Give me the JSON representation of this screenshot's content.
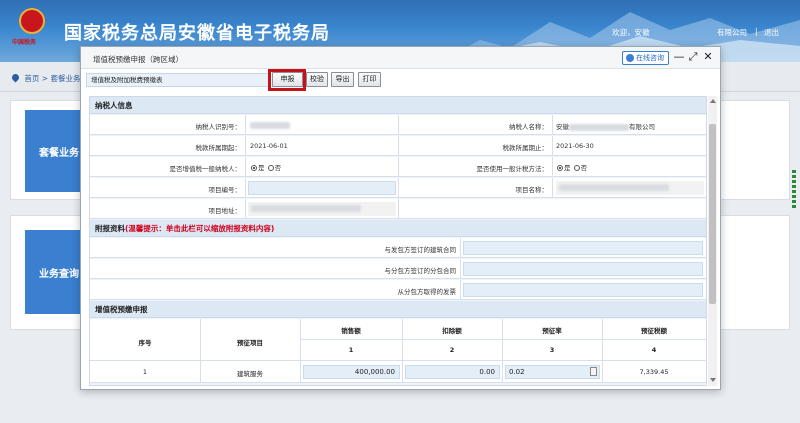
{
  "app": {
    "title": "国家税务总局安徽省电子税务局",
    "logo_text": "中国税务",
    "welcome": "欢迎，安徽",
    "company_suffix": "有限公司",
    "separator": "|",
    "logout": "退出"
  },
  "breadcrumb": {
    "home": "首页",
    "arrow": ">",
    "current": "套餐业务"
  },
  "tiles": [
    {
      "label": "套餐业务"
    },
    {
      "label": "业务查询"
    }
  ],
  "modal": {
    "title": "增值税预缴申报（跨区域）",
    "online_help": "在线咨询",
    "minimize": "—",
    "maximize": "⤢",
    "close": "✕"
  },
  "toolbar": {
    "form_select": "增值税及附加税费预缴表",
    "submit": "申报",
    "validate": "校验",
    "export": "导出",
    "print": "打印"
  },
  "taxpayer": {
    "section_title": "纳税人信息",
    "tax_id_label": "纳税人识别号：",
    "name_label": "纳税人名称：",
    "name_prefix": "安徽",
    "name_suffix": "有限公司",
    "period_start_label": "税款所属期起：",
    "period_start": "2021-06-01",
    "period_end_label": "税款所属期止：",
    "period_end": "2021-06-30",
    "general_taxpayer_label": "是否增值税一般纳税人：",
    "general_method_label": "是否使用一般计税方法：",
    "yes": "是",
    "no": "否",
    "project_no_label": "项目编号：",
    "project_name_label": "项目名称：",
    "project_addr_label": "项目地址："
  },
  "attachments": {
    "section_title": "附报资料",
    "tip": "(温馨提示：单击此栏可以缩放附报资料内容)",
    "rows": [
      "与发包方签订的建筑合同",
      "与分包方签订的分包合同",
      "从分包方取得的发票"
    ]
  },
  "prepay": {
    "section_title": "增值税预缴申报",
    "headers": {
      "seq": "序号",
      "item": "预征项目",
      "sales": "销售额",
      "deduction": "扣除额",
      "rate": "预征率",
      "tax": "预征税额"
    },
    "col_numbers": [
      "1",
      "2",
      "3",
      "4"
    ],
    "rows": [
      {
        "seq": "1",
        "item": "建筑服务",
        "sales": "400,000.00",
        "deduction": "0.00",
        "rate": "0.02",
        "tax": "7,339.45"
      }
    ]
  }
}
